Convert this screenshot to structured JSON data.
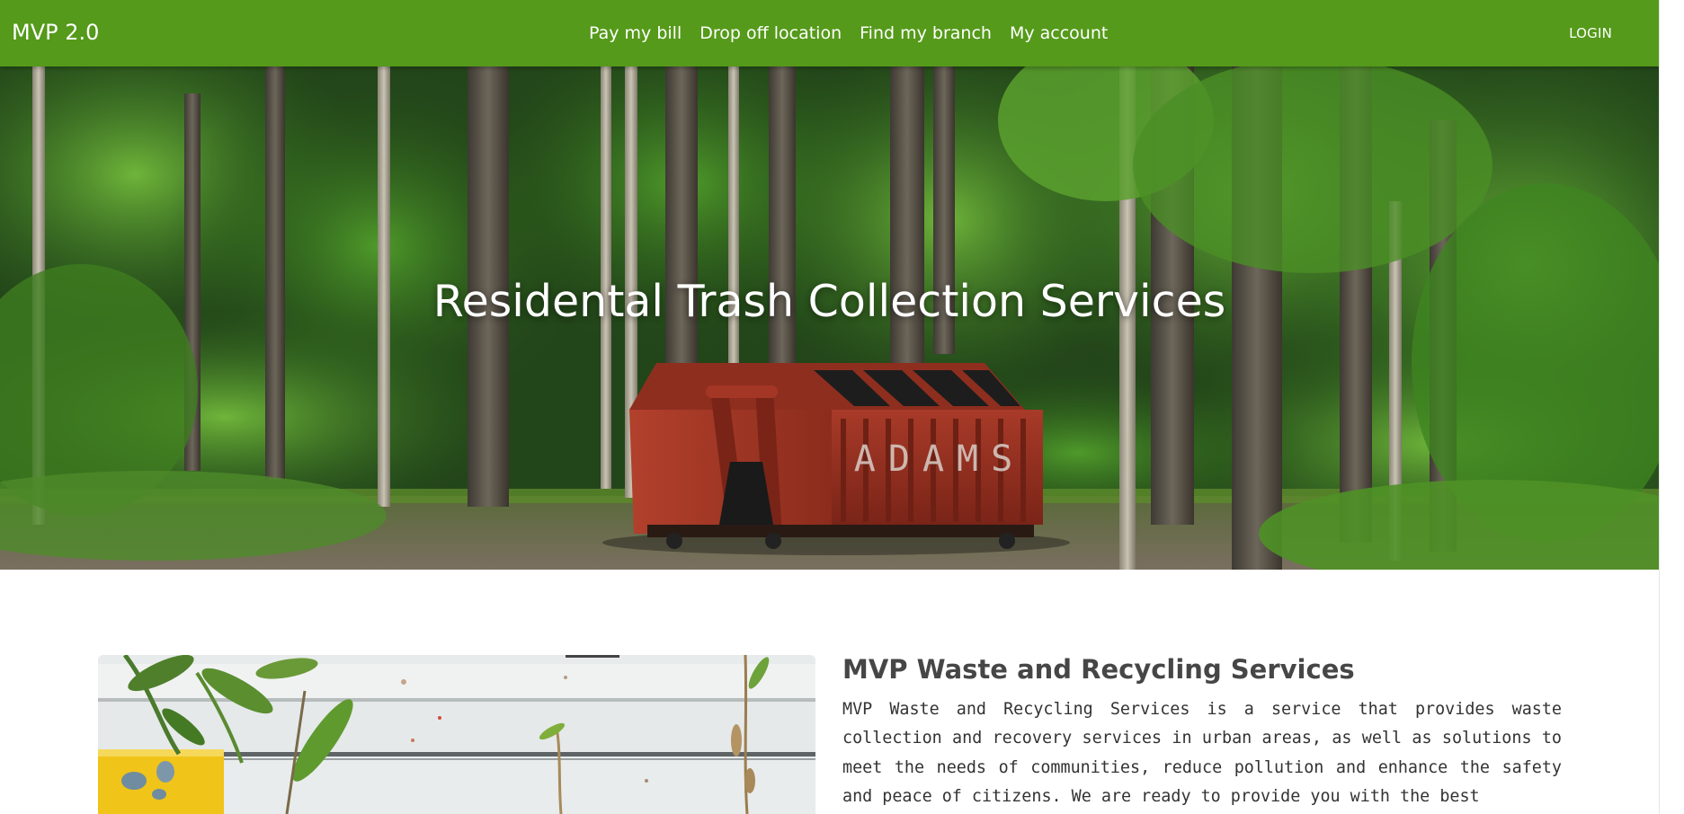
{
  "navbar": {
    "brand": "MVP 2.0",
    "links": [
      "Pay my bill",
      "Drop off location",
      "Find my branch",
      "My account"
    ],
    "login": "LOGIN",
    "color": "#559a1a"
  },
  "hero": {
    "title": "Residental Trash Collection Services",
    "dumpster_lettering": "ADAMS",
    "dumpster_color": "#9b3122"
  },
  "about": {
    "title": "MVP Waste and Recycling Services",
    "body": "MVP Waste and Recycling Services is a service that provides waste collection and recovery services in urban areas, as well as solutions to meet the needs of communities, reduce pollution and enhance the safety and peace of citizens. We are ready to provide you with the best"
  }
}
